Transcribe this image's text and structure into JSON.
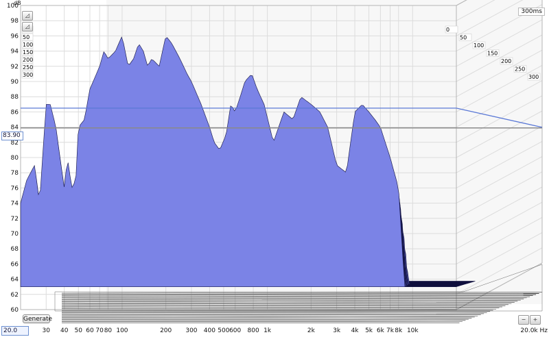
{
  "chart_data": {
    "type": "area",
    "style": "waterfall",
    "y_unit": "dB",
    "ylim": [
      60,
      100
    ],
    "y_ticks": [
      "100",
      "98",
      "96",
      "94",
      "92",
      "90",
      "88",
      "86",
      "84",
      "82",
      "80",
      "78",
      "76",
      "74",
      "72",
      "70",
      "68",
      "66",
      "64",
      "62",
      "60"
    ],
    "x_scale": "log",
    "xlim": [
      20,
      20000
    ],
    "x_ticks": [
      {
        "f": 30,
        "label": "30"
      },
      {
        "f": 40,
        "label": "40"
      },
      {
        "f": 50,
        "label": "50"
      },
      {
        "f": 60,
        "label": "60"
      },
      {
        "f": 70,
        "label": "70"
      },
      {
        "f": 80,
        "label": "80"
      },
      {
        "f": 100,
        "label": "100"
      },
      {
        "f": 200,
        "label": "200"
      },
      {
        "f": 300,
        "label": "300"
      },
      {
        "f": 400,
        "label": "400"
      },
      {
        "f": 500,
        "label": "500"
      },
      {
        "f": 600,
        "label": "600"
      },
      {
        "f": 800,
        "label": "800"
      },
      {
        "f": 1000,
        "label": "1k"
      },
      {
        "f": 2000,
        "label": "2k"
      },
      {
        "f": 3000,
        "label": "3k"
      },
      {
        "f": 4000,
        "label": "4k"
      },
      {
        "f": 5000,
        "label": "5k"
      },
      {
        "f": 6000,
        "label": "6k"
      },
      {
        "f": 7000,
        "label": "7k"
      },
      {
        "f": 8000,
        "label": "8k"
      },
      {
        "f": 10000,
        "label": "10k"
      }
    ],
    "x_end_label": "20.0k Hz",
    "time_unit": "ms",
    "time_ticks": [
      "0",
      "50",
      "100",
      "150",
      "200",
      "250",
      "300"
    ],
    "time_label": "300ms",
    "reference_level": 83.9,
    "reference_level_label": "83.90",
    "reference_level_2": 86.5,
    "series": [
      {
        "values": [
          [
            20,
            74
          ],
          [
            22,
            77
          ],
          [
            25,
            79
          ],
          [
            27,
            74
          ],
          [
            30,
            87
          ],
          [
            32,
            87
          ],
          [
            35,
            84
          ],
          [
            38,
            79
          ],
          [
            40,
            76
          ],
          [
            42,
            80
          ],
          [
            45,
            76
          ],
          [
            48,
            77
          ],
          [
            50,
            84
          ],
          [
            55,
            85
          ],
          [
            60,
            89
          ],
          [
            70,
            92
          ],
          [
            75,
            94
          ],
          [
            80,
            93
          ],
          [
            90,
            94
          ],
          [
            100,
            96
          ],
          [
            110,
            92
          ],
          [
            120,
            93
          ],
          [
            130,
            95
          ],
          [
            140,
            94
          ],
          [
            150,
            92
          ],
          [
            160,
            93
          ],
          [
            180,
            92
          ],
          [
            200,
            96
          ],
          [
            220,
            95
          ],
          [
            250,
            93
          ],
          [
            280,
            91
          ],
          [
            300,
            90
          ],
          [
            350,
            87
          ],
          [
            400,
            84
          ],
          [
            430,
            82
          ],
          [
            470,
            81
          ],
          [
            520,
            83
          ],
          [
            560,
            87
          ],
          [
            600,
            86
          ],
          [
            650,
            88
          ],
          [
            700,
            90
          ],
          [
            780,
            91
          ],
          [
            850,
            89
          ],
          [
            950,
            87
          ],
          [
            1100,
            82
          ],
          [
            1300,
            86
          ],
          [
            1500,
            85
          ],
          [
            1700,
            88
          ],
          [
            2000,
            87
          ],
          [
            2300,
            86
          ],
          [
            2600,
            84
          ],
          [
            3000,
            79
          ],
          [
            3500,
            78
          ],
          [
            4000,
            86
          ],
          [
            4500,
            87
          ],
          [
            5000,
            86
          ],
          [
            5500,
            85
          ],
          [
            6000,
            84
          ],
          [
            7000,
            80
          ],
          [
            8000,
            76
          ],
          [
            9000,
            60
          ],
          [
            20000,
            60
          ]
        ]
      }
    ]
  },
  "ui": {
    "generate_label": "Generate",
    "start_freq": "20.0",
    "y_unit_label": "dB"
  },
  "colors": {
    "fill": "#7b83e6",
    "outline": "#0d0d3c",
    "grid": "#dcdcdc",
    "floor": "#c6c6c6",
    "ref_line": "#8a8a8a",
    "ref_line_2": "#5a78d6"
  }
}
